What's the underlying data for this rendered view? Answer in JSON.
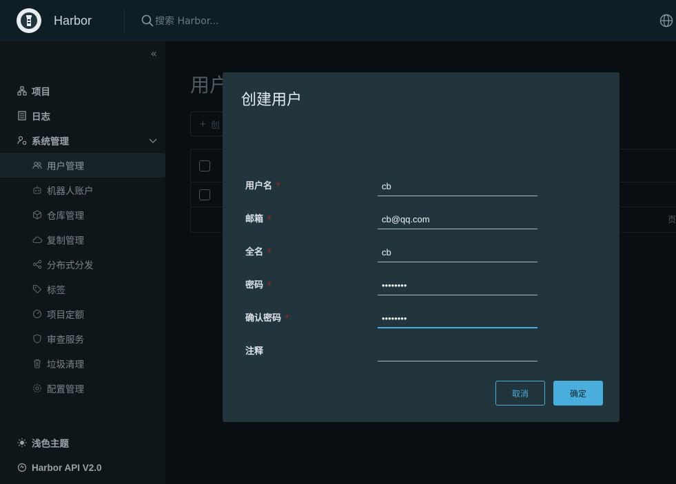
{
  "header": {
    "brand": "Harbor",
    "search_placeholder": "搜索 Harbor...",
    "logo_icon": "lighthouse-logo-icon",
    "language_icon": "globe-icon"
  },
  "sidebar": {
    "items": [
      {
        "label": "项目",
        "icon": "projects-icon"
      },
      {
        "label": "日志",
        "icon": "logs-icon"
      },
      {
        "label": "系统管理",
        "icon": "admin-icon"
      }
    ],
    "sub_items": [
      {
        "label": "用户管理",
        "icon": "users-icon",
        "active": true
      },
      {
        "label": "机器人账户",
        "icon": "robot-icon"
      },
      {
        "label": "仓库管理",
        "icon": "registry-icon"
      },
      {
        "label": "复制管理",
        "icon": "replication-icon"
      },
      {
        "label": "分布式分发",
        "icon": "distribution-icon"
      },
      {
        "label": "标签",
        "icon": "tag-icon"
      },
      {
        "label": "项目定额",
        "icon": "quota-icon"
      },
      {
        "label": "审查服务",
        "icon": "shield-icon"
      },
      {
        "label": "垃圾清理",
        "icon": "trash-icon"
      },
      {
        "label": "配置管理",
        "icon": "gear-icon"
      }
    ],
    "bottom": [
      {
        "label": "浅色主题",
        "icon": "sun-icon"
      },
      {
        "label": "Harbor API V2.0",
        "icon": "api-icon"
      }
    ]
  },
  "main": {
    "title": "用户",
    "create_button": "创",
    "footer_text": "页"
  },
  "modal": {
    "title": "创建用户",
    "fields": [
      {
        "label": "用户名",
        "required": true,
        "value": "cb"
      },
      {
        "label": "邮箱",
        "required": true,
        "value": "cb@qq.com"
      },
      {
        "label": "全名",
        "required": true,
        "value": "cb"
      },
      {
        "label": "密码",
        "required": true,
        "value": "••••••••"
      },
      {
        "label": "确认密码",
        "required": true,
        "value": "••••••••"
      },
      {
        "label": "注释",
        "required": false,
        "value": ""
      }
    ],
    "required_mark": "*",
    "cancel_label": "取消",
    "ok_label": "确定"
  },
  "colors": {
    "accent": "#49aedb",
    "modal_bg": "#22343c",
    "required": "#c92100"
  }
}
